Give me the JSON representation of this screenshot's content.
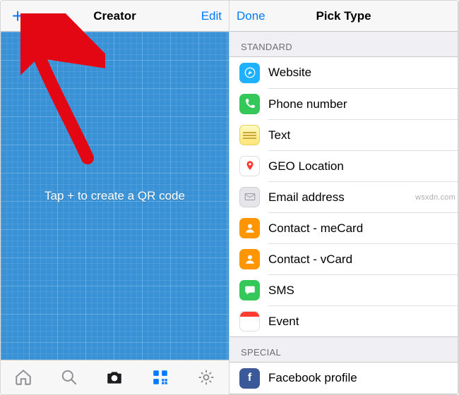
{
  "left": {
    "title": "Creator",
    "edit": "Edit",
    "hint": "Tap + to create a QR code",
    "tabs": {
      "home": "home-icon",
      "search": "search-icon",
      "camera": "camera-icon",
      "qr": "qr-icon",
      "settings": "gear-icon"
    }
  },
  "right": {
    "done": "Done",
    "title": "Pick Type",
    "section_standard": "Standard",
    "section_special": "Special",
    "items_standard": [
      {
        "label": "Website",
        "icon": "website"
      },
      {
        "label": "Phone number",
        "icon": "phone"
      },
      {
        "label": "Text",
        "icon": "text"
      },
      {
        "label": "GEO Location",
        "icon": "geo"
      },
      {
        "label": "Email address",
        "icon": "email"
      },
      {
        "label": "Contact - meCard",
        "icon": "contact"
      },
      {
        "label": "Contact - vCard",
        "icon": "contact"
      },
      {
        "label": "SMS",
        "icon": "sms"
      },
      {
        "label": "Event",
        "icon": "event"
      }
    ],
    "items_special": [
      {
        "label": "Facebook profile",
        "icon": "fb"
      }
    ]
  },
  "colors": {
    "tint": "#007aff",
    "blueprint": "#3a92d6"
  },
  "watermark": "wsxdn.com"
}
